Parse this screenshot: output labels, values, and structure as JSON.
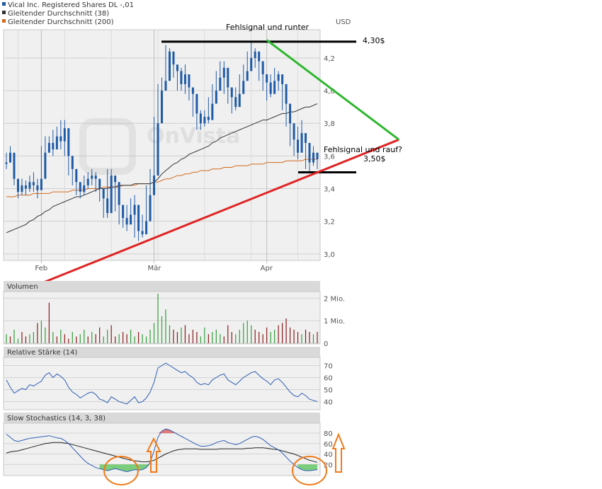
{
  "legend": [
    {
      "label": "Vical Inc. Registered Shares DL -,01",
      "color": "#1f5aa6"
    },
    {
      "label": "Gleitender Durchschnitt (38)",
      "color": "#333333"
    },
    {
      "label": "Gleitender Durchschnitt (200)",
      "color": "#d2691e"
    }
  ],
  "currency_label": "USD",
  "watermark": "OnVista",
  "colors": {
    "up": "#2f9e3a",
    "down": "#8b1a1a",
    "candle": "#1f5aa6",
    "ma38": "#333333",
    "ma200": "#d2691e",
    "panel_bg": "#f0f0f0",
    "header_bg": "#d9d9d9",
    "support": "#e02424",
    "resistance": "#2eb82e",
    "highlight": "#f07a1a"
  },
  "annotations": {
    "top_label": "Fehlsignal und runter",
    "resistance_label": "4,30$",
    "bottom_label": "Fehlsignal und rauf?",
    "support_label": "3,50$"
  },
  "panels": {
    "volume_title": "Volumen",
    "rsi_title": "Relative Stärke (14)",
    "stoch_title": "Slow Stochastics (14, 3, 38)"
  },
  "chart_data": [
    {
      "type": "candlestick",
      "title": "Vical Inc. Registered Shares DL -,01",
      "ylabel": "USD",
      "ylim": [
        2.96,
        4.33
      ],
      "yticks": [
        3.0,
        3.2,
        3.4,
        3.6,
        3.8,
        4.0,
        4.2
      ],
      "ytick_labels": [
        "3,0",
        "3,2",
        "3,4",
        "3,6",
        "3,8",
        "4,0",
        "4,2"
      ],
      "xtick_labels": [
        "Feb",
        "Mär",
        "Apr"
      ],
      "xtick_index": [
        9,
        38,
        67
      ],
      "close": [
        3.56,
        3.62,
        3.46,
        3.38,
        3.42,
        3.4,
        3.44,
        3.42,
        3.39,
        3.46,
        3.62,
        3.68,
        3.64,
        3.72,
        3.69,
        3.77,
        3.6,
        3.52,
        3.44,
        3.38,
        3.42,
        3.46,
        3.48,
        3.46,
        3.4,
        3.34,
        3.25,
        3.48,
        3.44,
        3.3,
        3.22,
        3.18,
        3.24,
        3.3,
        3.14,
        3.12,
        3.2,
        3.36,
        3.48,
        3.8,
        4.0,
        4.06,
        4.24,
        4.16,
        4.12,
        4.04,
        4.1,
        4.02,
        3.98,
        3.86,
        3.8,
        3.84,
        3.82,
        3.92,
        4.0,
        4.08,
        4.14,
        4.02,
        3.96,
        3.9,
        3.98,
        4.06,
        4.12,
        4.2,
        4.24,
        4.18,
        4.1,
        4.05,
        3.98,
        4.06,
        4.1,
        4.04,
        3.92,
        3.8,
        3.7,
        3.62,
        3.74,
        3.68,
        3.56,
        3.62,
        3.58
      ],
      "high": [
        3.62,
        3.66,
        3.5,
        3.45,
        3.46,
        3.45,
        3.48,
        3.5,
        3.46,
        3.66,
        3.72,
        3.72,
        3.76,
        3.78,
        3.82,
        3.82,
        3.64,
        3.56,
        3.52,
        3.44,
        3.48,
        3.5,
        3.52,
        3.5,
        3.46,
        3.38,
        3.52,
        3.52,
        3.48,
        3.34,
        3.28,
        3.3,
        3.34,
        3.36,
        3.2,
        3.24,
        3.42,
        3.52,
        3.84,
        4.04,
        4.08,
        4.28,
        4.26,
        4.22,
        4.14,
        4.14,
        4.16,
        4.06,
        4.02,
        3.9,
        3.88,
        3.88,
        3.96,
        4.04,
        4.12,
        4.18,
        4.18,
        4.06,
        4.0,
        4.02,
        4.1,
        4.16,
        4.24,
        4.3,
        4.26,
        4.22,
        4.14,
        4.08,
        4.1,
        4.14,
        4.12,
        4.06,
        3.94,
        3.84,
        3.78,
        3.78,
        3.82,
        3.7,
        3.66,
        3.66,
        3.62
      ],
      "low": [
        3.52,
        3.56,
        3.42,
        3.34,
        3.36,
        3.36,
        3.38,
        3.38,
        3.34,
        3.42,
        3.58,
        3.62,
        3.6,
        3.66,
        3.64,
        3.6,
        3.48,
        3.42,
        3.36,
        3.34,
        3.36,
        3.4,
        3.42,
        3.38,
        3.32,
        3.22,
        3.22,
        3.4,
        3.26,
        3.18,
        3.16,
        3.14,
        3.2,
        3.1,
        3.08,
        3.1,
        3.18,
        3.34,
        3.46,
        3.78,
        3.94,
        4.04,
        4.1,
        4.08,
        4.0,
        4.0,
        3.98,
        3.94,
        3.84,
        3.76,
        3.76,
        3.78,
        3.8,
        3.9,
        3.98,
        4.04,
        3.98,
        3.92,
        3.86,
        3.88,
        3.96,
        4.02,
        4.08,
        4.16,
        4.14,
        4.06,
        4.0,
        3.94,
        3.96,
        4.02,
        4.0,
        3.88,
        3.78,
        3.66,
        3.6,
        3.58,
        3.64,
        3.52,
        3.5,
        3.54,
        3.52
      ],
      "ma38": [
        3.13,
        3.14,
        3.15,
        3.16,
        3.17,
        3.18,
        3.2,
        3.21,
        3.23,
        3.24,
        3.26,
        3.27,
        3.29,
        3.3,
        3.31,
        3.32,
        3.33,
        3.34,
        3.35,
        3.35,
        3.36,
        3.37,
        3.38,
        3.39,
        3.4,
        3.4,
        3.4,
        3.41,
        3.41,
        3.42,
        3.42,
        3.42,
        3.42,
        3.43,
        3.43,
        3.43,
        3.43,
        3.43,
        3.44,
        3.46,
        3.49,
        3.51,
        3.53,
        3.55,
        3.56,
        3.58,
        3.59,
        3.61,
        3.62,
        3.63,
        3.64,
        3.65,
        3.66,
        3.68,
        3.69,
        3.71,
        3.72,
        3.73,
        3.74,
        3.75,
        3.76,
        3.77,
        3.78,
        3.79,
        3.8,
        3.81,
        3.82,
        3.82,
        3.83,
        3.84,
        3.85,
        3.86,
        3.86,
        3.87,
        3.87,
        3.88,
        3.89,
        3.9,
        3.9,
        3.91,
        3.92
      ],
      "ma200": [
        3.35,
        3.35,
        3.35,
        3.36,
        3.36,
        3.36,
        3.36,
        3.37,
        3.37,
        3.37,
        3.37,
        3.37,
        3.38,
        3.38,
        3.38,
        3.38,
        3.38,
        3.39,
        3.39,
        3.39,
        3.39,
        3.4,
        3.4,
        3.4,
        3.4,
        3.41,
        3.41,
        3.41,
        3.41,
        3.41,
        3.42,
        3.42,
        3.42,
        3.42,
        3.43,
        3.43,
        3.43,
        3.43,
        3.44,
        3.44,
        3.45,
        3.46,
        3.46,
        3.47,
        3.48,
        3.48,
        3.49,
        3.49,
        3.5,
        3.5,
        3.51,
        3.51,
        3.51,
        3.52,
        3.52,
        3.52,
        3.53,
        3.53,
        3.53,
        3.54,
        3.54,
        3.54,
        3.54,
        3.55,
        3.55,
        3.55,
        3.55,
        3.56,
        3.56,
        3.56,
        3.56,
        3.56,
        3.57,
        3.57,
        3.57,
        3.57,
        3.57,
        3.58,
        3.58,
        3.58,
        3.58
      ],
      "support_line": {
        "from": [
          9,
          2.82
        ],
        "to": [
          101,
          3.7
        ]
      },
      "resistance_line": {
        "from": [
          67,
          4.31
        ],
        "to": [
          101,
          3.7
        ]
      },
      "resistance_level": 4.3,
      "support_level": 3.5
    },
    {
      "type": "bar",
      "title": "Volumen",
      "ylim": [
        0,
        2.2
      ],
      "yticks": [
        0,
        1,
        2
      ],
      "ytick_labels": [
        "0",
        "1 Mio.",
        "2 Mio."
      ],
      "values": [
        0.4,
        0.3,
        0.6,
        0.2,
        0.5,
        0.3,
        0.4,
        0.5,
        0.9,
        1.0,
        0.7,
        1.8,
        0.5,
        0.3,
        0.6,
        0.4,
        0.2,
        0.5,
        0.3,
        0.4,
        0.6,
        0.3,
        0.5,
        0.4,
        0.7,
        0.3,
        0.6,
        0.8,
        0.3,
        0.4,
        0.5,
        0.4,
        0.6,
        0.3,
        0.5,
        0.4,
        0.3,
        0.6,
        0.9,
        2.2,
        1.2,
        1.5,
        0.8,
        0.6,
        0.5,
        0.7,
        0.8,
        0.4,
        0.6,
        0.5,
        0.3,
        0.7,
        0.4,
        0.5,
        0.6,
        0.4,
        0.3,
        0.8,
        0.5,
        0.4,
        0.6,
        0.9,
        1.0,
        0.8,
        0.6,
        0.5,
        0.4,
        0.7,
        0.5,
        0.6,
        0.8,
        0.9,
        1.1,
        0.7,
        0.6,
        0.5,
        0.4,
        0.6,
        0.5,
        0.4,
        0.5
      ],
      "up": [
        1,
        0,
        1,
        1,
        0,
        0,
        1,
        1,
        0,
        1,
        1,
        0,
        1,
        0,
        1,
        0,
        0,
        1,
        0,
        1,
        1,
        0,
        1,
        0,
        0,
        1,
        1,
        0,
        0,
        1,
        0,
        0,
        1,
        1,
        0,
        1,
        1,
        1,
        1,
        1,
        1,
        1,
        1,
        0,
        0,
        1,
        0,
        0,
        0,
        0,
        1,
        1,
        0,
        1,
        1,
        1,
        0,
        0,
        0,
        1,
        1,
        1,
        1,
        1,
        0,
        0,
        0,
        0,
        1,
        1,
        0,
        0,
        0,
        0,
        0,
        0,
        1,
        0,
        0,
        1,
        0
      ]
    },
    {
      "type": "line",
      "title": "Relative Stärke (14)",
      "ylim": [
        35,
        75
      ],
      "yticks": [
        40,
        50,
        60,
        70
      ],
      "values": [
        58,
        52,
        47,
        49,
        51,
        50,
        54,
        53,
        55,
        57,
        62,
        64,
        60,
        63,
        61,
        58,
        52,
        48,
        46,
        43,
        45,
        47,
        48,
        46,
        42,
        41,
        39,
        44,
        42,
        40,
        39,
        38,
        41,
        44,
        39,
        40,
        43,
        48,
        56,
        68,
        70,
        72,
        70,
        68,
        66,
        64,
        65,
        62,
        60,
        56,
        54,
        55,
        54,
        58,
        60,
        62,
        63,
        58,
        56,
        54,
        57,
        60,
        62,
        64,
        65,
        62,
        59,
        57,
        54,
        58,
        59,
        56,
        52,
        48,
        45,
        44,
        47,
        45,
        42,
        41,
        40
      ]
    },
    {
      "type": "line",
      "title": "Slow Stochastics (14, 3, 38)",
      "ylim": [
        0,
        95
      ],
      "yticks": [
        20,
        40,
        60,
        80
      ],
      "k": [
        78,
        72,
        66,
        64,
        66,
        68,
        70,
        71,
        72,
        73,
        74,
        75,
        73,
        71,
        70,
        66,
        60,
        52,
        44,
        36,
        28,
        22,
        18,
        14,
        12,
        10,
        8,
        10,
        12,
        10,
        8,
        6,
        8,
        10,
        9,
        10,
        14,
        24,
        46,
        72,
        84,
        88,
        86,
        82,
        78,
        74,
        70,
        66,
        62,
        58,
        55,
        55,
        56,
        58,
        62,
        64,
        66,
        62,
        60,
        58,
        60,
        64,
        68,
        72,
        74,
        72,
        68,
        62,
        56,
        52,
        48,
        42,
        34,
        26,
        20,
        14,
        10,
        8,
        8,
        9,
        10
      ],
      "d": [
        42,
        44,
        45,
        46,
        48,
        50,
        52,
        54,
        56,
        58,
        60,
        61,
        62,
        62,
        62,
        61,
        60,
        58,
        56,
        54,
        52,
        50,
        48,
        46,
        44,
        42,
        40,
        38,
        36,
        34,
        32,
        30,
        28,
        27,
        26,
        25,
        25,
        26,
        28,
        32,
        36,
        40,
        43,
        46,
        48,
        49,
        50,
        50,
        50,
        50,
        49,
        49,
        49,
        49,
        49,
        50,
        50,
        50,
        50,
        50,
        50,
        50,
        51,
        51,
        52,
        52,
        52,
        51,
        50,
        49,
        48,
        46,
        44,
        42,
        40,
        37,
        34,
        31,
        28,
        26,
        24
      ],
      "oversold_highlights": [
        [
          24,
          37
        ],
        [
          75,
          80
        ]
      ],
      "overbought_highlight": [
        39,
        46
      ]
    }
  ]
}
